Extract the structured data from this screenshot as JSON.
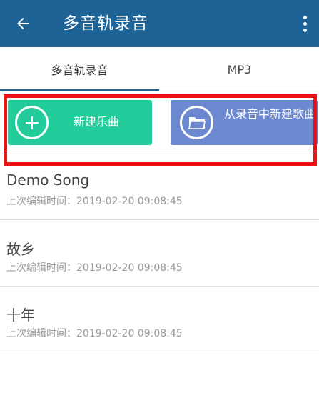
{
  "appbar": {
    "title": "多音轨录音"
  },
  "tabs": [
    {
      "label": "多音轨录音",
      "active": true
    },
    {
      "label": "MP3",
      "active": false
    }
  ],
  "actions": {
    "new_song": "新建乐曲",
    "from_recording": "从录音中新建歌曲"
  },
  "songs": [
    {
      "title": "Demo Song",
      "edited": "上次编辑时间：2019-02-20 09:08:45"
    },
    {
      "title": "故乡",
      "edited": "上次编辑时间：2019-02-20 09:08:45"
    },
    {
      "title": "十年",
      "edited": "上次编辑时间：2019-02-20 09:08:45"
    }
  ],
  "colors": {
    "appbar": "#1e6396",
    "new_button": "#21cc9a",
    "from_button": "#6c88cf",
    "highlight": "#ee1111"
  },
  "icons": {
    "back": "arrow-left-icon",
    "menu": "more-vertical-icon",
    "new": "plus-circle-icon",
    "from": "folder-icon"
  }
}
